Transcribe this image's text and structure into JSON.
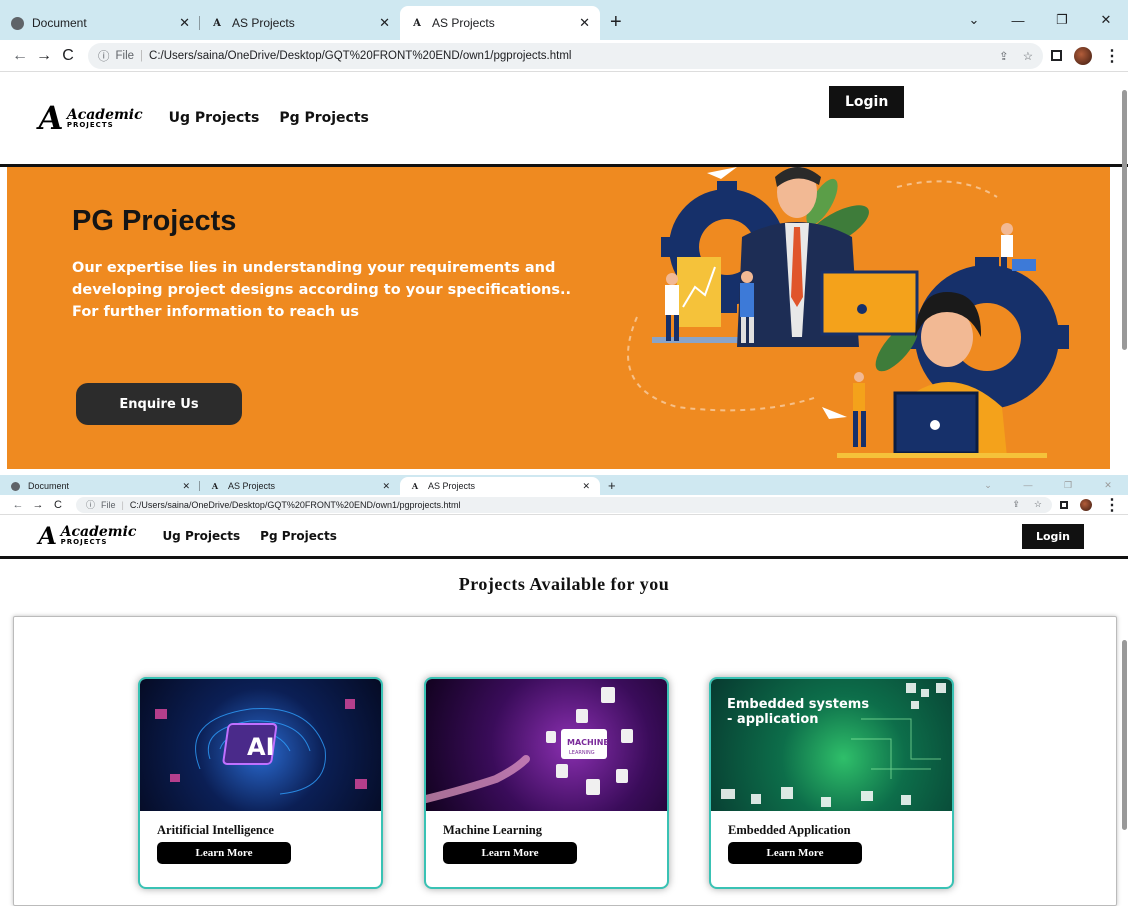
{
  "browser_top": {
    "tabs": [
      {
        "label": "Document",
        "favicon": "globe-icon"
      },
      {
        "label": "AS Projects",
        "favicon": "A"
      },
      {
        "label": "AS Projects",
        "favicon": "A"
      }
    ],
    "new_tab": "+",
    "address": "C:/Users/saina/OneDrive/Desktop/GQT%20FRONT%20END/own1/pgprojects.html",
    "file_label": "File"
  },
  "site": {
    "logo_mark": "A",
    "logo_line1": "Academic",
    "logo_line2": "PROJECTS",
    "nav": [
      "Ug Projects",
      "Pg Projects"
    ],
    "login": "Login"
  },
  "hero": {
    "title": "PG Projects",
    "description": "Our expertise lies in understanding your requirements and developing project designs according to your specifications.. For further information to reach us",
    "button": "Enquire Us",
    "bg_color": "#ef8a20"
  },
  "projects": {
    "heading": "Projects Available for you",
    "cards": [
      {
        "title": "Aritificial Intelligence",
        "button": "Learn More",
        "image_text": "AI"
      },
      {
        "title": "Machine Learning",
        "button": "Learn More",
        "image_text": "MACHINE LEARNING"
      },
      {
        "title": "Embedded Application",
        "button": "Learn More",
        "image_text_1": "Embedded systems",
        "image_text_2": "- application"
      }
    ],
    "accent": "#39c2b4"
  }
}
